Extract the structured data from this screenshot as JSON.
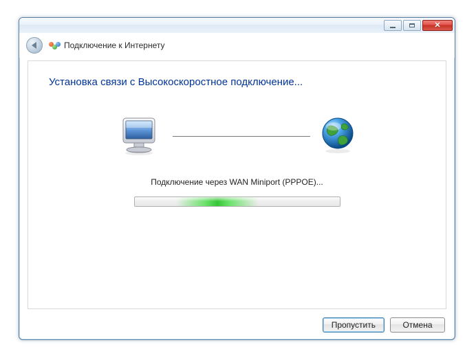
{
  "window": {
    "title": "Подключение к Интернету"
  },
  "content": {
    "heading": "Установка связи с Высокоскоростное подключение...",
    "status": "Подключение через WAN Miniport (PPPOE)..."
  },
  "buttons": {
    "skip": "Пропустить",
    "cancel": "Отмена"
  }
}
